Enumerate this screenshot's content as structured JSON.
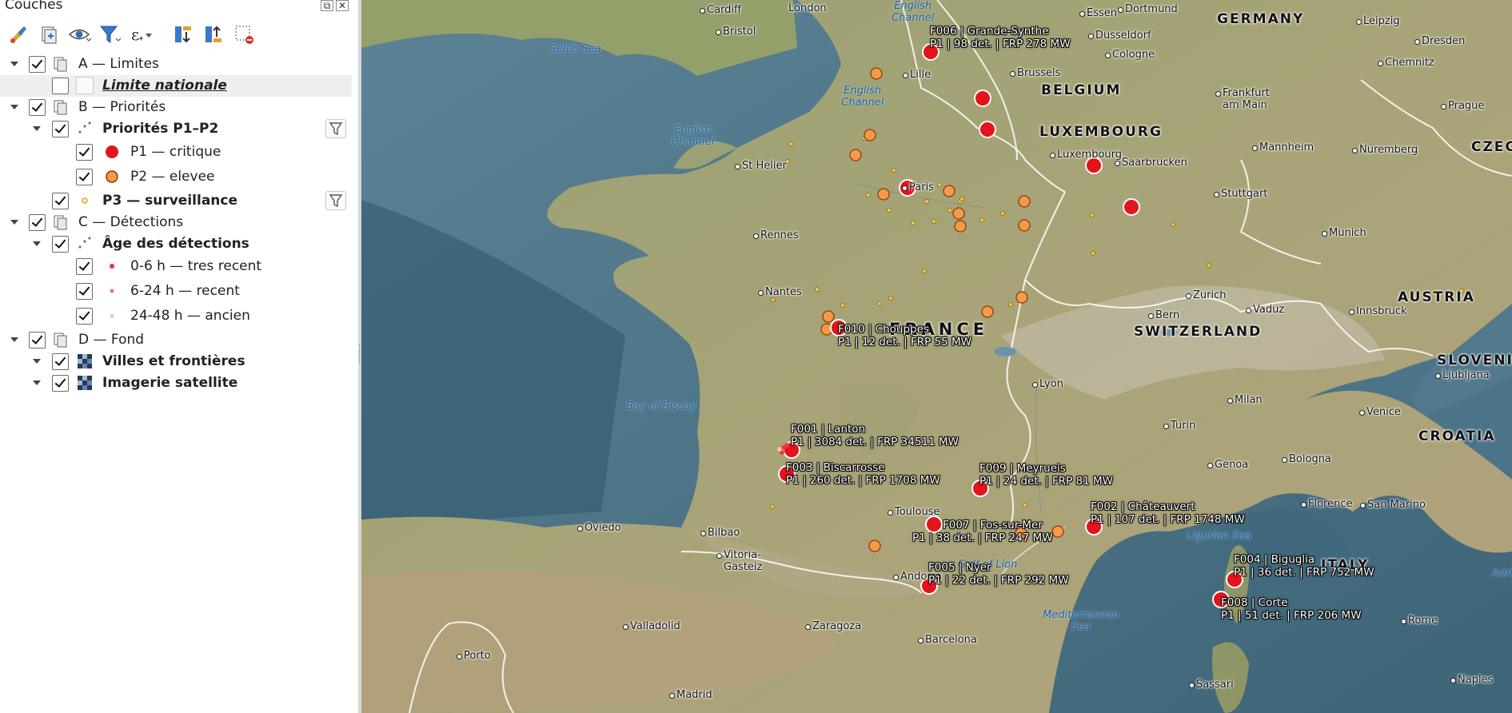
{
  "panel": {
    "title": "Couches",
    "toolbar": [
      {
        "icon": "style-brush-icon"
      },
      {
        "icon": "add-group-icon"
      },
      {
        "icon": "eye-visibility-icon"
      },
      {
        "icon": "filter-legend-icon"
      },
      {
        "icon": "expression-filter-icon"
      },
      {
        "icon": "expand-all-icon"
      },
      {
        "icon": "collapse-all-icon"
      },
      {
        "icon": "remove-layer-icon"
      }
    ],
    "tree": {
      "group_a": "A — Limites",
      "limite_nationale": "Limite nationale",
      "group_b": "B — Priorités",
      "priorites_p1p2": "Priorités P1–P2",
      "p1": "P1 — critique",
      "p2": "P2 — elevee",
      "p3": "P3 — surveillance",
      "group_c": "C — Détections",
      "age": "Âge des détections",
      "age_0_6": "0-6 h — tres recent",
      "age_6_24": "6-24 h — recent",
      "age_24_48": "24-48 h — ancien",
      "group_d": "D — Fond",
      "villes": "Villes et frontières",
      "imagerie": "Imagerie satellite"
    }
  },
  "colors": {
    "p1": "#e3141b",
    "p2": "#f59b46",
    "p3": "#f2c64a",
    "age_0_6": "#e8393a",
    "age_6_24": "#ef7d6c",
    "age_24_48": "#f5c59a"
  },
  "map": {
    "countries": {
      "germany": "GERMANY",
      "belgium": "BELGIUM",
      "luxembourg": "LUXEMBOURG",
      "france": "FRANCE",
      "switzerland": "SWITZERLAND",
      "austria": "AUSTRIA",
      "slovenia": "SLOVENIA",
      "croatia": "CROATIA",
      "italy": "ITALY",
      "czech": "CZEC"
    },
    "seas": {
      "celtic": "Celtic Sea",
      "english_channel_1": "English\nChannel",
      "english_channel_2": "English\nChannel",
      "english_channel_3": "English\nChannel",
      "biscay": "Bay of Biscay",
      "ligurian": "Ligurian Sea",
      "med": "Mediterranean\nSea",
      "lion": "Gulf of Lion"
    },
    "cities": {
      "cardiff": "Cardiff",
      "london": "London",
      "bristol": "Bristol",
      "essen": "Essen",
      "dortmund": "Dortmund",
      "dusseldorf": "Dusseldorf",
      "cologne": "Cologne",
      "leipzig": "Leipzig",
      "dresden": "Dresden",
      "chemnitz": "Chemnitz",
      "lille": "Lille",
      "brussels": "Brussels",
      "frankfurt": "Frankfurt\nam Main",
      "prague": "Prague",
      "mannheim": "Mannheim",
      "nuremberg": "Nuremberg",
      "luxembourg": "Luxembourg",
      "saarbrucken": "Saarbrucken",
      "sthelier": "St Helier",
      "paris": "Paris",
      "stuttgart": "Stuttgart",
      "rennes": "Rennes",
      "munich": "Munich",
      "nantes": "Nantes",
      "zurich": "Zurich",
      "vaduz": "Vaduz",
      "bern": "Bern",
      "innsbruck": "Innsbruck",
      "ljubljana": "Ljubljana",
      "lyon": "Lyon",
      "milan": "Milan",
      "venice": "Venice",
      "turin": "Turin",
      "bologna": "Bologna",
      "genoa": "Genoa",
      "florence": "Florence",
      "sanmarino": "San Marino",
      "toulouse": "Toulouse",
      "oviedo": "Oviedo",
      "bilbao": "Bilbao",
      "vitoria": "Vitoria-\nGasteiz",
      "andorra": "Andorra",
      "zaragoza": "Zaragoza",
      "valladolid": "Valladolid",
      "porto": "Porto",
      "barcelona": "Barcelona",
      "madrid": "Madrid",
      "rome": "Rome",
      "sassari": "Sassari",
      "naples": "Naples",
      "ade": "Adri"
    },
    "fires": [
      {
        "id": "F006",
        "line1": "F006 | Grande-Synthe",
        "line2": "P1 | 98 det. | FRP 278 MW"
      },
      {
        "id": "F010",
        "line1": "F010 | Chouppes",
        "line2": "P1 | 12 det. | FRP 55 MW"
      },
      {
        "id": "F001",
        "line1": "F001 | Lanton",
        "line2": "P1 | 3084 det. | FRP 34511 MW"
      },
      {
        "id": "F003",
        "line1": "F003 | Biscarrosse",
        "line2": "P1 | 260 det. | FRP 1708 MW"
      },
      {
        "id": "F009",
        "line1": "F009 | Meyrueis",
        "line2": "P1 | 24 det. | FRP 81 MW"
      },
      {
        "id": "F002",
        "line1": "F002 | Châteauvert",
        "line2": "P1 | 107 det. | FRP 1748 MW"
      },
      {
        "id": "F007",
        "line1": "F007 | Fos-sur-Mer",
        "line2": "P1 | 38 det. | FRP 247 MW"
      },
      {
        "id": "F005",
        "line1": "F005 | Nyer",
        "line2": "P1 | 22 det. | FRP 292 MW"
      },
      {
        "id": "F004",
        "line1": "F004 | Biguglia",
        "line2": "P1 | 36 det. | FRP 752 MW"
      },
      {
        "id": "F008",
        "line1": "F008 | Corte",
        "line2": "P1 | 51 det. | FRP 206 MW"
      }
    ]
  }
}
